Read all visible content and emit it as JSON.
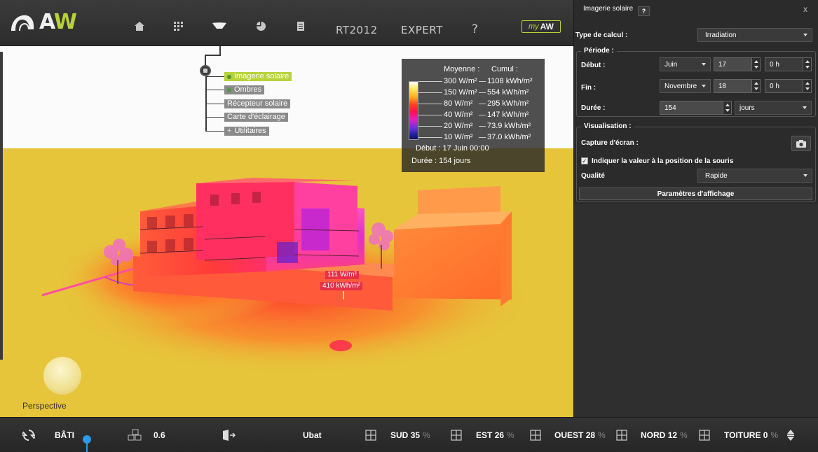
{
  "app": {
    "logo_text_a": "A",
    "logo_text_w": "W",
    "nav": {
      "home_icon": "home-icon",
      "grid_icon": "grid-icon",
      "sun_icon": "solar-icon",
      "pie_icon": "pie-chart-icon",
      "doc_icon": "document-icon",
      "rt2012": "RT2012",
      "expert": "EXPERT",
      "help": "?",
      "myaw_my": "my",
      "myaw_aw": "AW"
    }
  },
  "tree": {
    "items": [
      {
        "label": "Imagerie solaire",
        "active": true,
        "dot": true
      },
      {
        "label": "Ombres",
        "active": false,
        "dot": true
      },
      {
        "label": "Récepteur solaire",
        "active": false,
        "dot": false
      },
      {
        "label": "Carte d'éclairage",
        "active": false,
        "dot": false
      },
      {
        "label": "Utilitaires",
        "active": false,
        "dot": false,
        "plus": "+"
      }
    ]
  },
  "legend": {
    "header_avg": "Moyenne :",
    "header_cum": "Cumul :",
    "rows": [
      {
        "avg": "300 W/m²",
        "cum": "1108 kWh/m²"
      },
      {
        "avg": "150 W/m²",
        "cum": "554 kWh/m²"
      },
      {
        "avg": "80 W/m²",
        "cum": "295 kWh/m²"
      },
      {
        "avg": "40 W/m²",
        "cum": "147 kWh/m²"
      },
      {
        "avg": "20 W/m²",
        "cum": "73.9 kWh/m²"
      },
      {
        "avg": "10 W/m²",
        "cum": "37.0 kWh/m²"
      }
    ],
    "debut": "Début : 17 Juin 00:00",
    "duree": "Durée : 154 jours"
  },
  "scene": {
    "tag_avg": "111 W/m²",
    "tag_cum": "410 kWh/m²",
    "perspective": "Perspective"
  },
  "panel": {
    "title": "Imagerie solaire",
    "help": "?",
    "close": "x",
    "type_label": "Type de calcul :",
    "type_value": "Irradiation",
    "periode_label": "Période :",
    "debut_label": "Début :",
    "debut_month": "Juin",
    "debut_day": "17",
    "debut_hour": "0 h",
    "fin_label": "Fin :",
    "fin_month": "Novembre",
    "fin_day": "18",
    "fin_hour": "0 h",
    "duree_label": "Durée :",
    "duree_value": "154",
    "duree_unit": "jours",
    "visu_label": "Visualisation :",
    "capture_label": "Capture d'écran :",
    "indicate_label": "Indiquer la valeur à la position de la souris",
    "indicate_checked": true,
    "qualite_label": "Qualité",
    "qualite_value": "Rapide",
    "params_button": "Paramètres d'affichage"
  },
  "bottom": {
    "bati": "BÂTI",
    "value_06": "0.6",
    "ubat": "Ubat",
    "sud_label": "SUD",
    "sud_value": "35",
    "est_label": "EST",
    "est_value": "26",
    "ouest_label": "OUEST",
    "ouest_value": "28",
    "nord_label": "NORD",
    "nord_value": "12",
    "toiture_label": "TOITURE",
    "toiture_value": "0",
    "pct": "%"
  },
  "colors": {
    "accent": "#b8d23a",
    "ground": "#e6c53a",
    "panel_bg": "#2b2b2b",
    "highlight": "#e53048"
  }
}
